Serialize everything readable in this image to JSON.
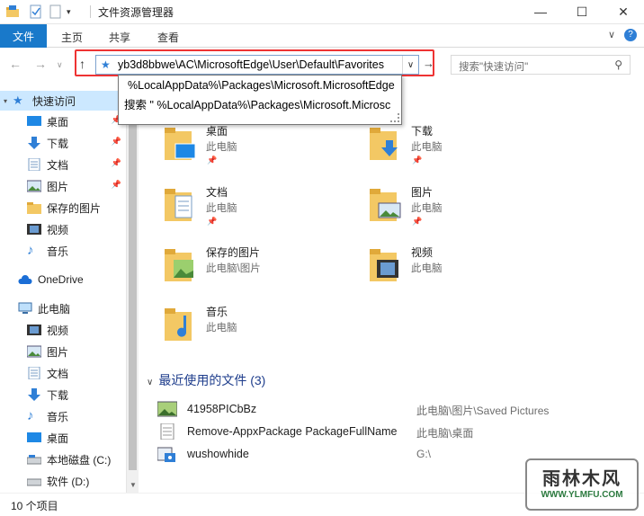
{
  "window": {
    "title": "文件资源管理器",
    "controls": {
      "minimize": "—",
      "maximize": "☐",
      "close": "✕"
    }
  },
  "ribbon": {
    "tabs": [
      "文件",
      "主页",
      "共享",
      "查看"
    ],
    "expand": "∨",
    "help": "?"
  },
  "nav": {
    "back": "←",
    "forward": "→",
    "recent": "∨",
    "up": "↑",
    "address_value": "yb3d8bbwe\\AC\\MicrosoftEdge\\User\\Default\\Favorites",
    "address_dropdown": "∨",
    "go": "→",
    "search_placeholder": "搜索\"快速访问\""
  },
  "autocomplete": {
    "options": [
      "%LocalAppData%\\Packages\\Microsoft.MicrosoftEdge",
      "搜索 \" %LocalAppData%\\Packages\\Microsoft.Microsc"
    ]
  },
  "sidebar": {
    "items": [
      {
        "label": "快速访问",
        "icon": "star-icon"
      },
      {
        "label": "桌面",
        "icon": "desktop-icon",
        "pinned": true
      },
      {
        "label": "下载",
        "icon": "download-icon",
        "pinned": true
      },
      {
        "label": "文档",
        "icon": "document-icon",
        "pinned": true
      },
      {
        "label": "图片",
        "icon": "picture-icon",
        "pinned": true
      },
      {
        "label": "保存的图片",
        "icon": "folder-icon"
      },
      {
        "label": "视频",
        "icon": "video-icon"
      },
      {
        "label": "音乐",
        "icon": "music-icon"
      },
      {
        "label": "OneDrive",
        "icon": "cloud-icon"
      },
      {
        "label": "此电脑",
        "icon": "computer-icon"
      },
      {
        "label": "视频",
        "icon": "video-icon"
      },
      {
        "label": "图片",
        "icon": "picture-icon"
      },
      {
        "label": "文档",
        "icon": "document-icon"
      },
      {
        "label": "下载",
        "icon": "download-icon"
      },
      {
        "label": "音乐",
        "icon": "music-icon"
      },
      {
        "label": "桌面",
        "icon": "desktop-icon"
      },
      {
        "label": "本地磁盘 (C:)",
        "icon": "drive-icon"
      },
      {
        "label": "软件 (D:)",
        "icon": "drive-icon"
      }
    ]
  },
  "main": {
    "frequent": [
      {
        "name": "桌面",
        "location": "此电脑",
        "pinned": true
      },
      {
        "name": "下载",
        "location": "此电脑",
        "pinned": true
      },
      {
        "name": "文档",
        "location": "此电脑",
        "pinned": true
      },
      {
        "name": "图片",
        "location": "此电脑",
        "pinned": true
      },
      {
        "name": "保存的图片",
        "location": "此电脑\\图片"
      },
      {
        "name": "视频",
        "location": "此电脑"
      },
      {
        "name": "音乐",
        "location": "此电脑"
      }
    ],
    "recent_header": "最近使用的文件 (3)",
    "recent": [
      {
        "name": "41958PICbBz",
        "location": "此电脑\\图片\\Saved Pictures"
      },
      {
        "name": "Remove-AppxPackage PackageFullName",
        "location": "此电脑\\桌面"
      },
      {
        "name": "wushowhide",
        "location": "G:\\"
      }
    ]
  },
  "status": {
    "count": "10 个项目"
  },
  "watermark": {
    "line1": "雨林木风",
    "line2": "WWW.YLMFU.COM"
  },
  "colors": {
    "accent": "#1979ca",
    "highlight": "#cce8ff",
    "annotation": "#e33333",
    "folder": "#f3c864"
  }
}
